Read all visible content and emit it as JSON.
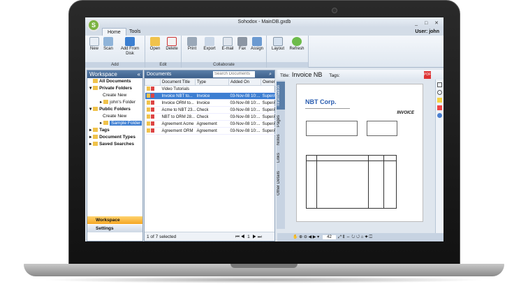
{
  "window": {
    "title": "Sohodox - MainDB.gxdb",
    "logo_letter": "S"
  },
  "tabs": [
    "Home",
    "Tools"
  ],
  "user_label": "User: john",
  "ribbon": {
    "add": {
      "label": "Add",
      "buttons": [
        "New",
        "Scan",
        "Add From Disk"
      ]
    },
    "edit": {
      "label": "Edit",
      "buttons": [
        "Open",
        "Delete"
      ]
    },
    "collaborate": {
      "label": "Collaborate",
      "buttons": [
        "Print",
        "Export",
        "E-mail",
        "Fax",
        "Assign"
      ]
    },
    "view": {
      "buttons": [
        "Layout",
        "Refresh"
      ]
    }
  },
  "workspace": {
    "title": "Workspace",
    "tree": [
      {
        "label": "All Documents",
        "bold": true
      },
      {
        "label": "Private Folders",
        "bold": true
      },
      {
        "label": "Create New"
      },
      {
        "label": "john's Folder"
      },
      {
        "label": "Public Folders",
        "bold": true
      },
      {
        "label": "Create New"
      },
      {
        "label": "Sample Folder",
        "selected": true
      },
      {
        "label": "Tags",
        "bold": true
      },
      {
        "label": "Document Types",
        "bold": true
      },
      {
        "label": "Saved Searches",
        "bold": true
      }
    ],
    "bottom_buttons": [
      "Workspace",
      "Settings"
    ]
  },
  "documents": {
    "title": "Documents",
    "search_placeholder": "Search Documents",
    "columns": [
      "Document Title",
      "Type",
      "Added On",
      "Owner"
    ],
    "rows": [
      [
        "Video Tutorials",
        "",
        "",
        ""
      ],
      [
        "Invoice NBT to...",
        "Invoice",
        "03-Nov-08 10:...",
        "SuperA"
      ],
      [
        "Invoice ORM to...",
        "Invoice",
        "03-Nov-08 10:...",
        "SuperA"
      ],
      [
        "Acme to NBT 23...",
        "Check",
        "03-Nov-08 10:...",
        "SuperA"
      ],
      [
        "NBT to ORM 28...",
        "Check",
        "03-Nov-08 10:...",
        "SuperA"
      ],
      [
        "Agreement Acme",
        "Agreement",
        "03-Nov-08 10:...",
        "SuperA"
      ],
      [
        "Agreement ORM",
        "Agreement",
        "03-Nov-08 10:...",
        "SuperA"
      ]
    ],
    "selected_index": 1,
    "footer": "1 of 7 selected",
    "page": "1"
  },
  "side_tabs": [
    "Information",
    "Pages",
    "Notes",
    "Links",
    "Other Details"
  ],
  "preview": {
    "title_label": "Title:",
    "title": "Invoice NB",
    "tags_label": "Tags:",
    "company": "NBT Corp.",
    "invoice_heading": "INVOICE",
    "zoom": "42"
  }
}
